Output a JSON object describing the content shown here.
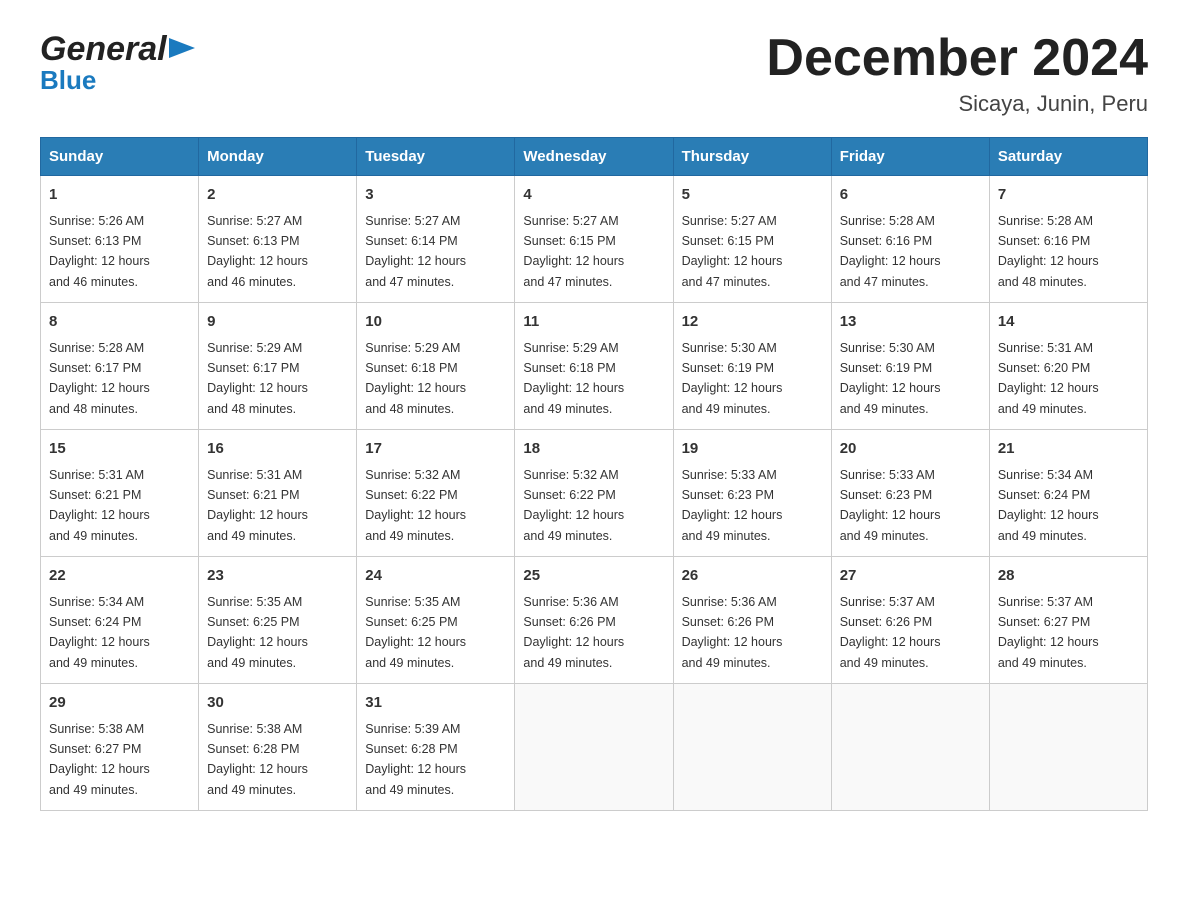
{
  "logo": {
    "name": "GeneralBlue",
    "line1": "General",
    "line2": "Blue"
  },
  "header": {
    "month_year": "December 2024",
    "location": "Sicaya, Junin, Peru"
  },
  "days_of_week": [
    "Sunday",
    "Monday",
    "Tuesday",
    "Wednesday",
    "Thursday",
    "Friday",
    "Saturday"
  ],
  "weeks": [
    [
      {
        "day": "1",
        "sunrise": "5:26 AM",
        "sunset": "6:13 PM",
        "daylight": "12 hours and 46 minutes."
      },
      {
        "day": "2",
        "sunrise": "5:27 AM",
        "sunset": "6:13 PM",
        "daylight": "12 hours and 46 minutes."
      },
      {
        "day": "3",
        "sunrise": "5:27 AM",
        "sunset": "6:14 PM",
        "daylight": "12 hours and 47 minutes."
      },
      {
        "day": "4",
        "sunrise": "5:27 AM",
        "sunset": "6:15 PM",
        "daylight": "12 hours and 47 minutes."
      },
      {
        "day": "5",
        "sunrise": "5:27 AM",
        "sunset": "6:15 PM",
        "daylight": "12 hours and 47 minutes."
      },
      {
        "day": "6",
        "sunrise": "5:28 AM",
        "sunset": "6:16 PM",
        "daylight": "12 hours and 47 minutes."
      },
      {
        "day": "7",
        "sunrise": "5:28 AM",
        "sunset": "6:16 PM",
        "daylight": "12 hours and 48 minutes."
      }
    ],
    [
      {
        "day": "8",
        "sunrise": "5:28 AM",
        "sunset": "6:17 PM",
        "daylight": "12 hours and 48 minutes."
      },
      {
        "day": "9",
        "sunrise": "5:29 AM",
        "sunset": "6:17 PM",
        "daylight": "12 hours and 48 minutes."
      },
      {
        "day": "10",
        "sunrise": "5:29 AM",
        "sunset": "6:18 PM",
        "daylight": "12 hours and 48 minutes."
      },
      {
        "day": "11",
        "sunrise": "5:29 AM",
        "sunset": "6:18 PM",
        "daylight": "12 hours and 49 minutes."
      },
      {
        "day": "12",
        "sunrise": "5:30 AM",
        "sunset": "6:19 PM",
        "daylight": "12 hours and 49 minutes."
      },
      {
        "day": "13",
        "sunrise": "5:30 AM",
        "sunset": "6:19 PM",
        "daylight": "12 hours and 49 minutes."
      },
      {
        "day": "14",
        "sunrise": "5:31 AM",
        "sunset": "6:20 PM",
        "daylight": "12 hours and 49 minutes."
      }
    ],
    [
      {
        "day": "15",
        "sunrise": "5:31 AM",
        "sunset": "6:21 PM",
        "daylight": "12 hours and 49 minutes."
      },
      {
        "day": "16",
        "sunrise": "5:31 AM",
        "sunset": "6:21 PM",
        "daylight": "12 hours and 49 minutes."
      },
      {
        "day": "17",
        "sunrise": "5:32 AM",
        "sunset": "6:22 PM",
        "daylight": "12 hours and 49 minutes."
      },
      {
        "day": "18",
        "sunrise": "5:32 AM",
        "sunset": "6:22 PM",
        "daylight": "12 hours and 49 minutes."
      },
      {
        "day": "19",
        "sunrise": "5:33 AM",
        "sunset": "6:23 PM",
        "daylight": "12 hours and 49 minutes."
      },
      {
        "day": "20",
        "sunrise": "5:33 AM",
        "sunset": "6:23 PM",
        "daylight": "12 hours and 49 minutes."
      },
      {
        "day": "21",
        "sunrise": "5:34 AM",
        "sunset": "6:24 PM",
        "daylight": "12 hours and 49 minutes."
      }
    ],
    [
      {
        "day": "22",
        "sunrise": "5:34 AM",
        "sunset": "6:24 PM",
        "daylight": "12 hours and 49 minutes."
      },
      {
        "day": "23",
        "sunrise": "5:35 AM",
        "sunset": "6:25 PM",
        "daylight": "12 hours and 49 minutes."
      },
      {
        "day": "24",
        "sunrise": "5:35 AM",
        "sunset": "6:25 PM",
        "daylight": "12 hours and 49 minutes."
      },
      {
        "day": "25",
        "sunrise": "5:36 AM",
        "sunset": "6:26 PM",
        "daylight": "12 hours and 49 minutes."
      },
      {
        "day": "26",
        "sunrise": "5:36 AM",
        "sunset": "6:26 PM",
        "daylight": "12 hours and 49 minutes."
      },
      {
        "day": "27",
        "sunrise": "5:37 AM",
        "sunset": "6:26 PM",
        "daylight": "12 hours and 49 minutes."
      },
      {
        "day": "28",
        "sunrise": "5:37 AM",
        "sunset": "6:27 PM",
        "daylight": "12 hours and 49 minutes."
      }
    ],
    [
      {
        "day": "29",
        "sunrise": "5:38 AM",
        "sunset": "6:27 PM",
        "daylight": "12 hours and 49 minutes."
      },
      {
        "day": "30",
        "sunrise": "5:38 AM",
        "sunset": "6:28 PM",
        "daylight": "12 hours and 49 minutes."
      },
      {
        "day": "31",
        "sunrise": "5:39 AM",
        "sunset": "6:28 PM",
        "daylight": "12 hours and 49 minutes."
      },
      null,
      null,
      null,
      null
    ]
  ],
  "labels": {
    "sunrise": "Sunrise:",
    "sunset": "Sunset:",
    "daylight": "Daylight: 12 hours"
  }
}
